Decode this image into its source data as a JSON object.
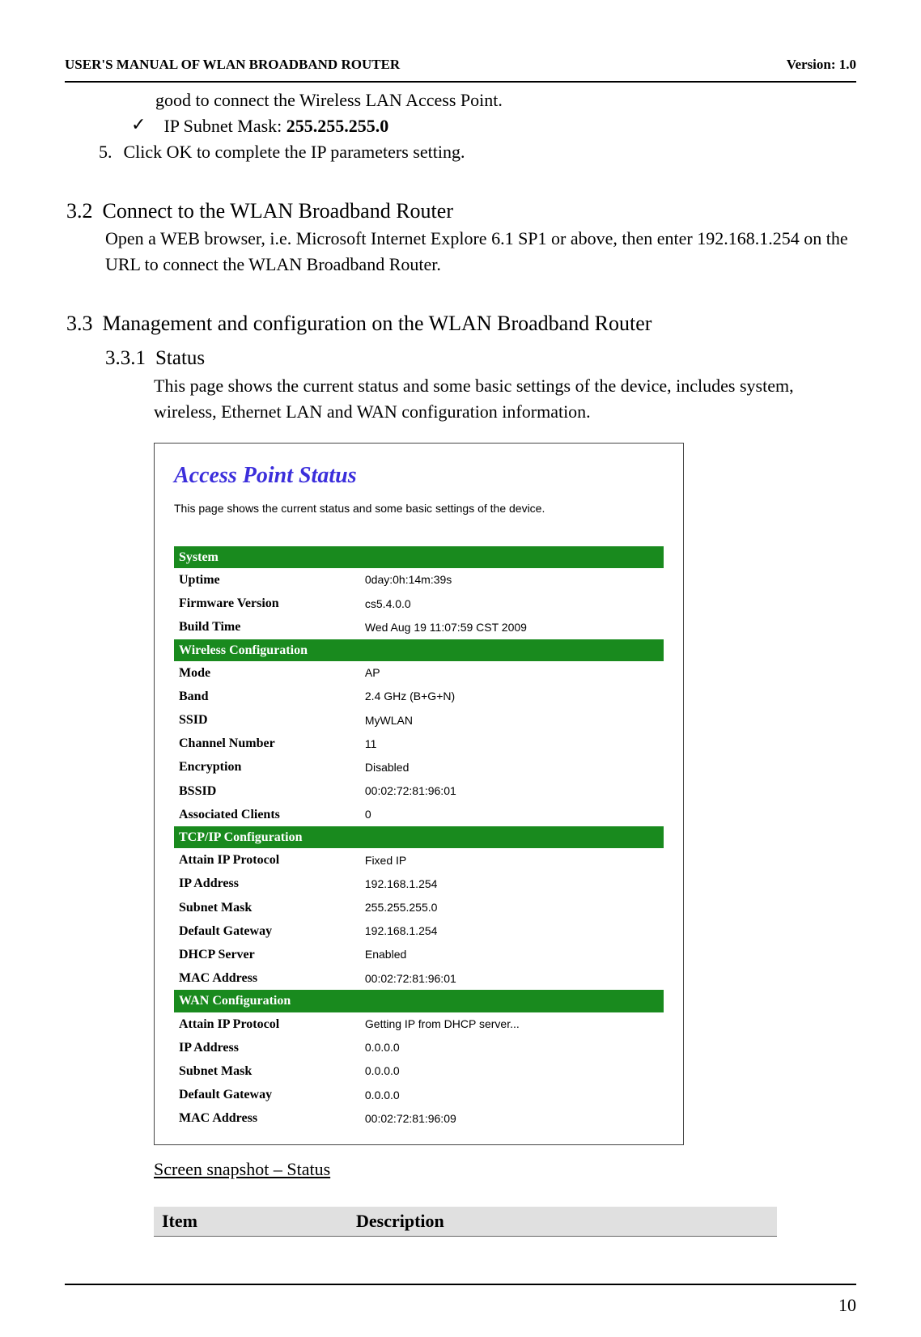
{
  "header": {
    "left": "USER'S MANUAL OF WLAN BROADBAND ROUTER",
    "right": "Version: 1.0"
  },
  "body": {
    "line_connect_good": "good to connect the Wireless LAN Access Point.",
    "subnet_prefix": "IP Subnet Mask: ",
    "subnet_value": "255.255.255.0",
    "step5_num": "5.",
    "step5_text": "Click OK to complete the IP parameters setting.",
    "sec32_num": "3.2",
    "sec32_title": "Connect to the WLAN Broadband Router",
    "sec32_body": "Open a WEB browser, i.e. Microsoft Internet Explore 6.1 SP1 or above, then enter 192.168.1.254 on the URL to connect the WLAN Broadband Router.",
    "sec33_num": "3.3",
    "sec33_title": "Management and configuration on the WLAN Broadband Router",
    "sub331_num": "3.3.1",
    "sub331_title": "Status",
    "sub331_body": "This page shows the current status and some basic settings of the device, includes system, wireless, Ethernet LAN and WAN configuration information."
  },
  "screenshot": {
    "title": "Access Point Status",
    "desc": "This page shows the current status and some basic settings of the device.",
    "sections": [
      {
        "name": "System",
        "rows": [
          {
            "label": "Uptime",
            "value": "0day:0h:14m:39s"
          },
          {
            "label": "Firmware Version",
            "value": "cs5.4.0.0"
          },
          {
            "label": "Build Time",
            "value": "Wed Aug 19 11:07:59 CST 2009"
          }
        ]
      },
      {
        "name": "Wireless Configuration",
        "rows": [
          {
            "label": "Mode",
            "value": "AP"
          },
          {
            "label": "Band",
            "value": "2.4 GHz (B+G+N)"
          },
          {
            "label": "SSID",
            "value": "MyWLAN"
          },
          {
            "label": "Channel Number",
            "value": "11"
          },
          {
            "label": "Encryption",
            "value": "Disabled"
          },
          {
            "label": "BSSID",
            "value": "00:02:72:81:96:01"
          },
          {
            "label": "Associated Clients",
            "value": "0"
          }
        ]
      },
      {
        "name": "TCP/IP Configuration",
        "rows": [
          {
            "label": "Attain IP Protocol",
            "value": "Fixed IP"
          },
          {
            "label": "IP Address",
            "value": "192.168.1.254"
          },
          {
            "label": "Subnet Mask",
            "value": "255.255.255.0"
          },
          {
            "label": "Default Gateway",
            "value": "192.168.1.254"
          },
          {
            "label": "DHCP Server",
            "value": "Enabled"
          },
          {
            "label": "MAC Address",
            "value": "00:02:72:81:96:01"
          }
        ]
      },
      {
        "name": "WAN Configuration",
        "rows": [
          {
            "label": "Attain IP Protocol",
            "value": "Getting IP from DHCP server..."
          },
          {
            "label": "IP Address",
            "value": "0.0.0.0"
          },
          {
            "label": "Subnet Mask",
            "value": "0.0.0.0"
          },
          {
            "label": "Default Gateway",
            "value": "0.0.0.0"
          },
          {
            "label": "MAC Address",
            "value": "00:02:72:81:96:09"
          }
        ]
      }
    ]
  },
  "caption": "Screen snapshot – Status",
  "table_head": {
    "item": "Item",
    "desc": "Description"
  },
  "page_number": "10"
}
